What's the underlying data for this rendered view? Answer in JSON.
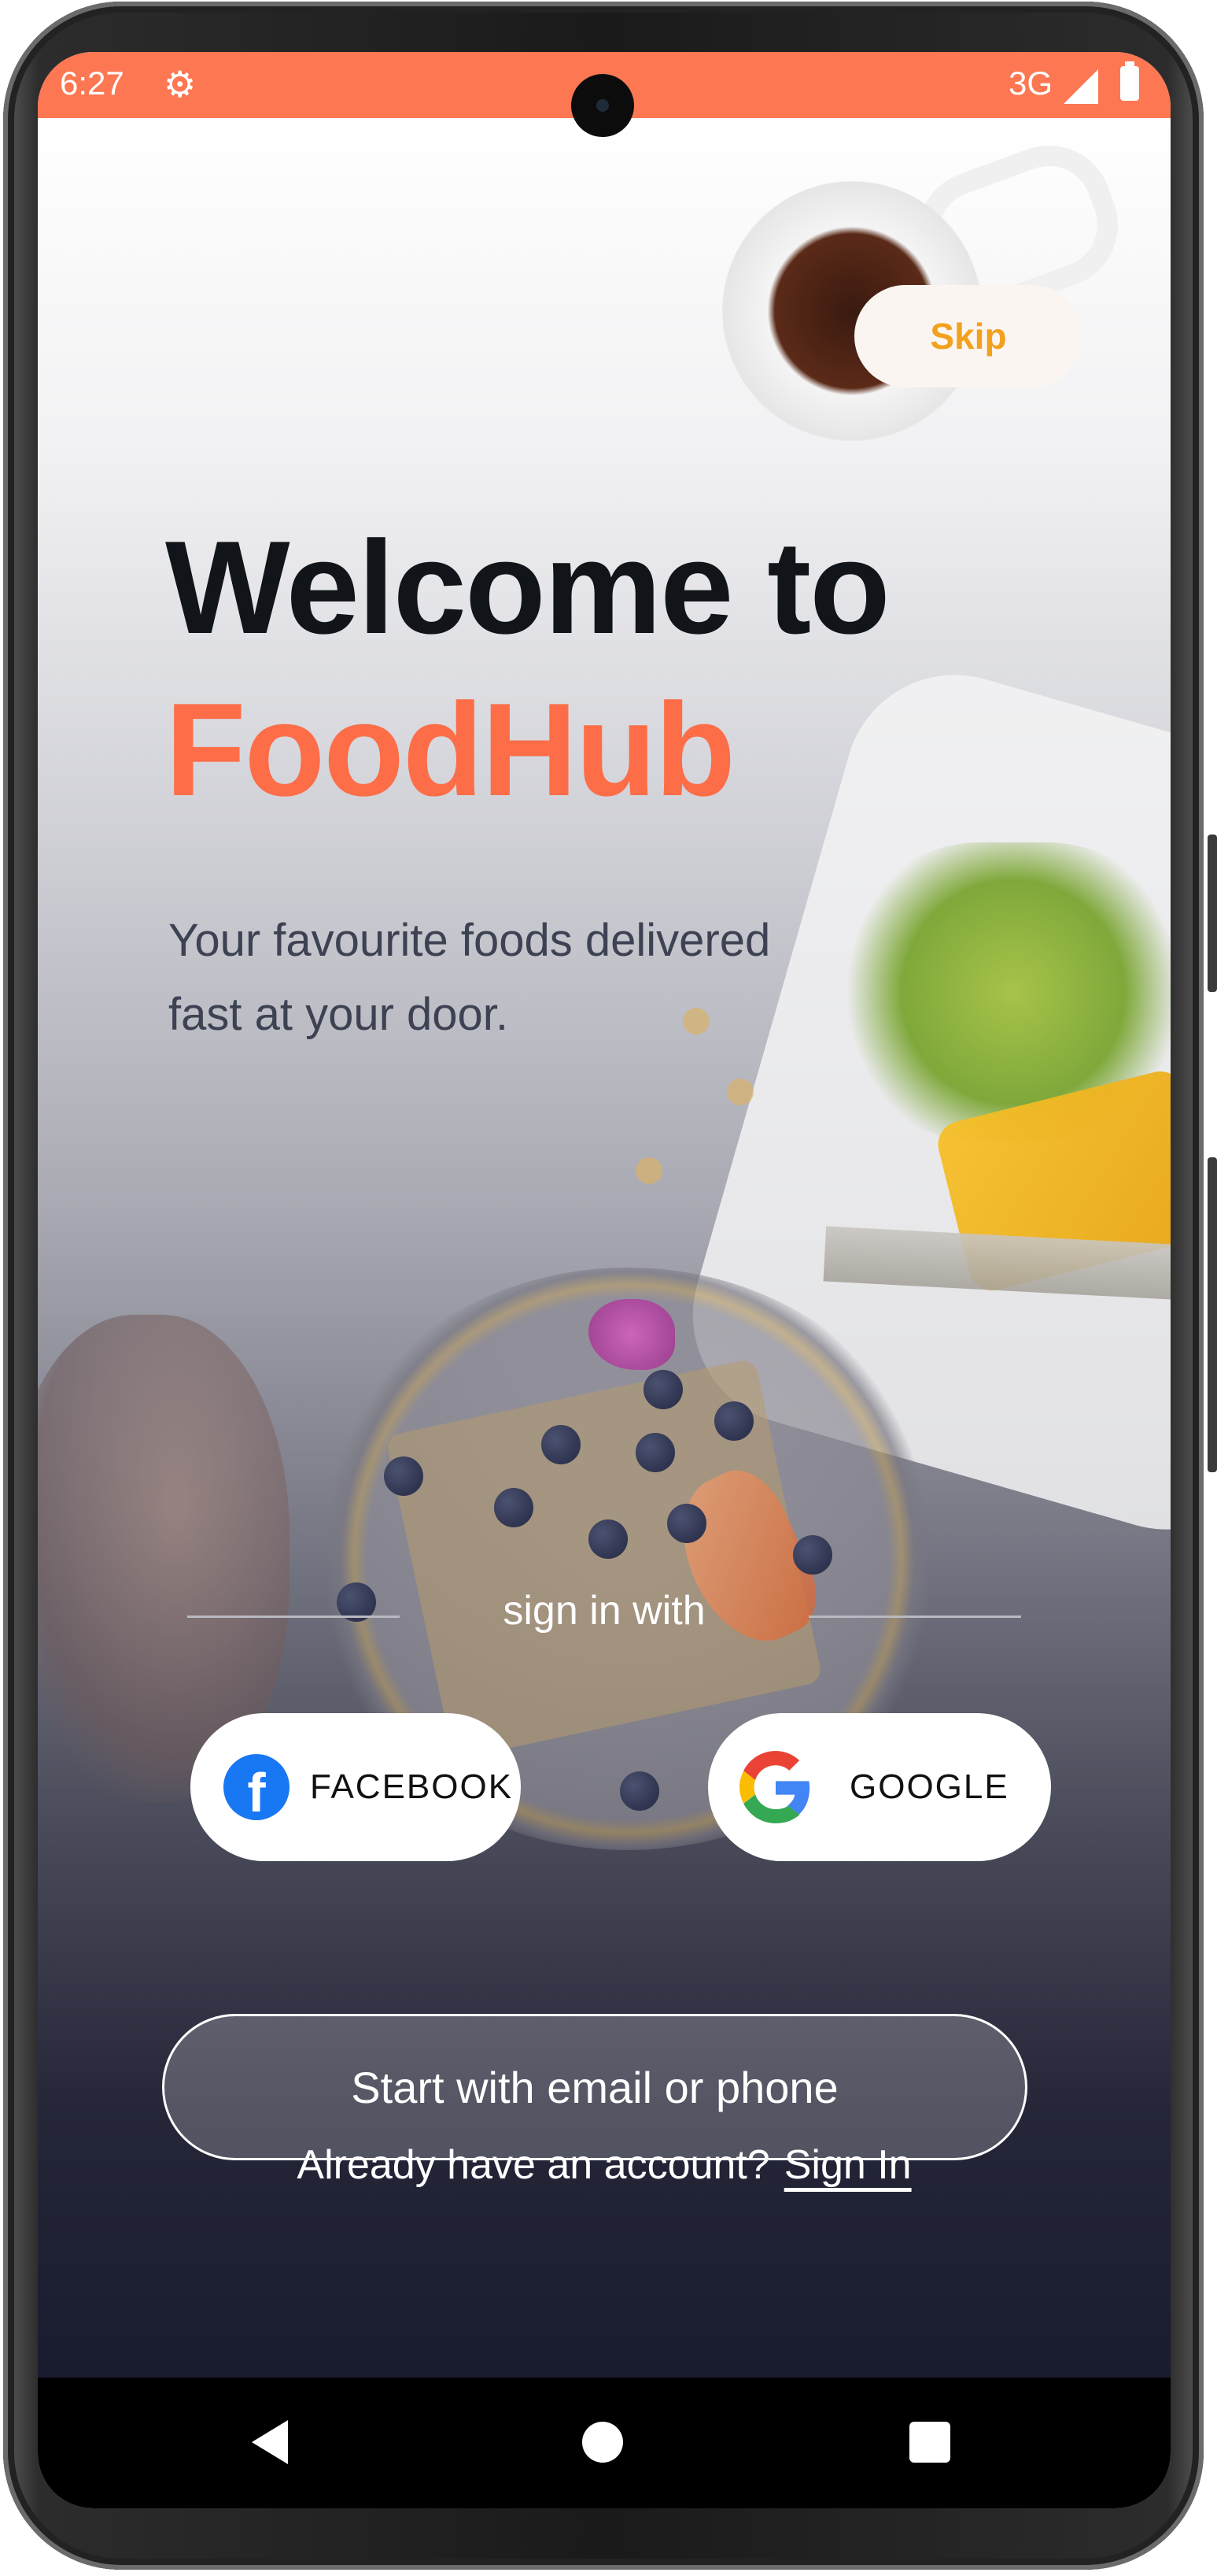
{
  "status_bar": {
    "time": "6:27",
    "network": "3G",
    "settings_icon": "gear-icon",
    "signal_icon": "signal-icon",
    "battery_icon": "battery-icon",
    "bg_color": "#fc7752"
  },
  "skip_label": "Skip",
  "welcome": {
    "line1": "Welcome to",
    "line2": "FoodHub",
    "subtitle_line1": "Your favourite foods delivered",
    "subtitle_line2": "fast at your door."
  },
  "social": {
    "divider_text": "sign in with",
    "facebook_label": "FACEBOOK",
    "google_label": "GOOGLE",
    "facebook_icon": "facebook-icon",
    "google_icon": "google-icon"
  },
  "email_button_label": "Start with email or phone",
  "account": {
    "prompt": "Already have an account?",
    "link": "Sign In"
  },
  "nav": {
    "back_icon": "back-triangle-icon",
    "home_icon": "home-circle-icon",
    "recents_icon": "recents-square-icon"
  },
  "colors": {
    "accent": "#fc6d48",
    "skip_text": "#f2a11d",
    "title_dark": "#111418"
  }
}
